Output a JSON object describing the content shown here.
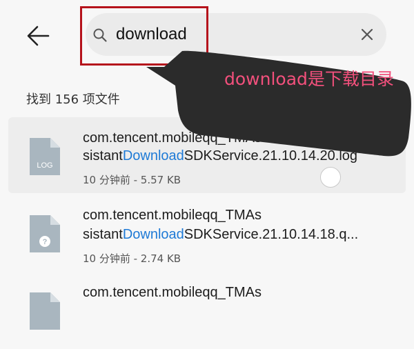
{
  "search": {
    "query": "download",
    "highlight_color": "#b5121b"
  },
  "results": {
    "count_label": "找到 156 项文件",
    "files": [
      {
        "icon": "log-file-icon",
        "icon_label": "LOG",
        "name_line1": "com.tencent.mobileqq_TMAs",
        "name_prefix": "sistant",
        "name_match": "Download",
        "name_suffix": "SDKService.21.10.14.20.log",
        "meta": "10 分钟前 - 5.57 KB",
        "selected": true
      },
      {
        "icon": "unknown-file-icon",
        "icon_label": "?",
        "name_line1": "com.tencent.mobileqq_TMAs",
        "name_prefix": "sistant",
        "name_match": "Download",
        "name_suffix": "SDKService.21.10.14.18.q...",
        "meta": "10 分钟前 - 2.74 KB",
        "selected": false
      },
      {
        "icon": "file-icon",
        "icon_label": "",
        "name_line1": "com.tencent.mobileqq_TMAs",
        "name_prefix": "",
        "name_match": "",
        "name_suffix": "",
        "meta": "",
        "selected": false
      }
    ]
  },
  "annotation": {
    "text": "download是下载目录",
    "color": "#f2507c",
    "bubble_color": "#2b2b2b"
  },
  "colors": {
    "match_highlight": "#1e7ad6",
    "icon_gray": "#a9b6bf"
  }
}
